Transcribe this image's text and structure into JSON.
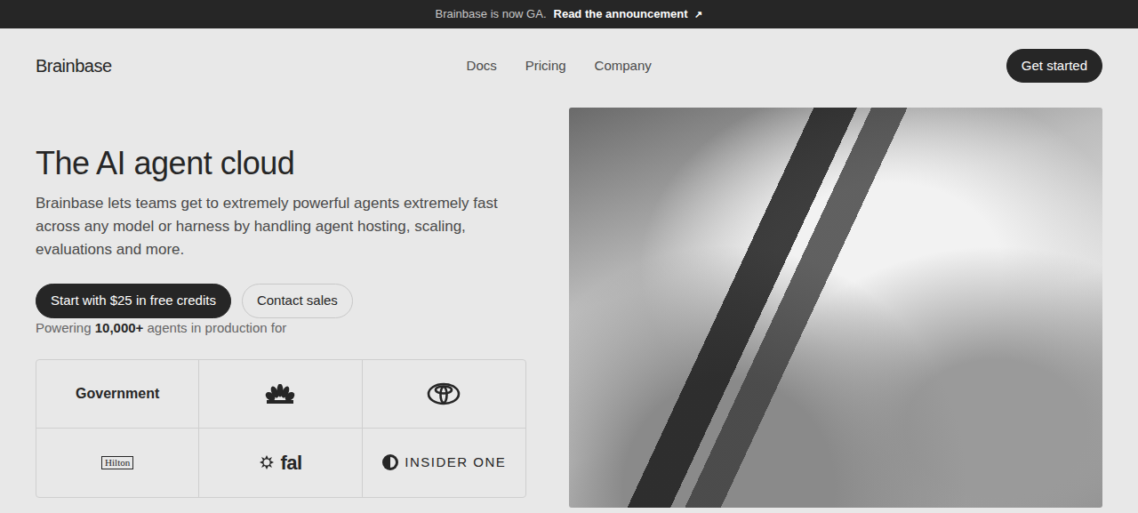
{
  "banner": {
    "text": "Brainbase is now GA.",
    "link": "Read the announcement",
    "arrow": "↗"
  },
  "nav": {
    "logo": "Brainbase",
    "links": [
      "Docs",
      "Pricing",
      "Company"
    ],
    "cta": "Get started"
  },
  "hero": {
    "title": "The AI agent cloud",
    "description": "Brainbase lets teams get to extremely powerful agents extremely fast across any model or harness by handling agent hosting, scaling, evaluations and more.",
    "primary": "Start with $25 in free credits",
    "secondary": "Contact sales",
    "powering": {
      "prefix": "Powering",
      "count": "10,000+",
      "suffix": "agents in production for"
    }
  },
  "logos": [
    {
      "kind": "text",
      "label": "Government"
    },
    {
      "kind": "nbc"
    },
    {
      "kind": "toyota"
    },
    {
      "kind": "hilton",
      "label": "Hilton"
    },
    {
      "kind": "fal",
      "label": "fal"
    },
    {
      "kind": "insider",
      "label": "INSIDER ONE"
    }
  ]
}
